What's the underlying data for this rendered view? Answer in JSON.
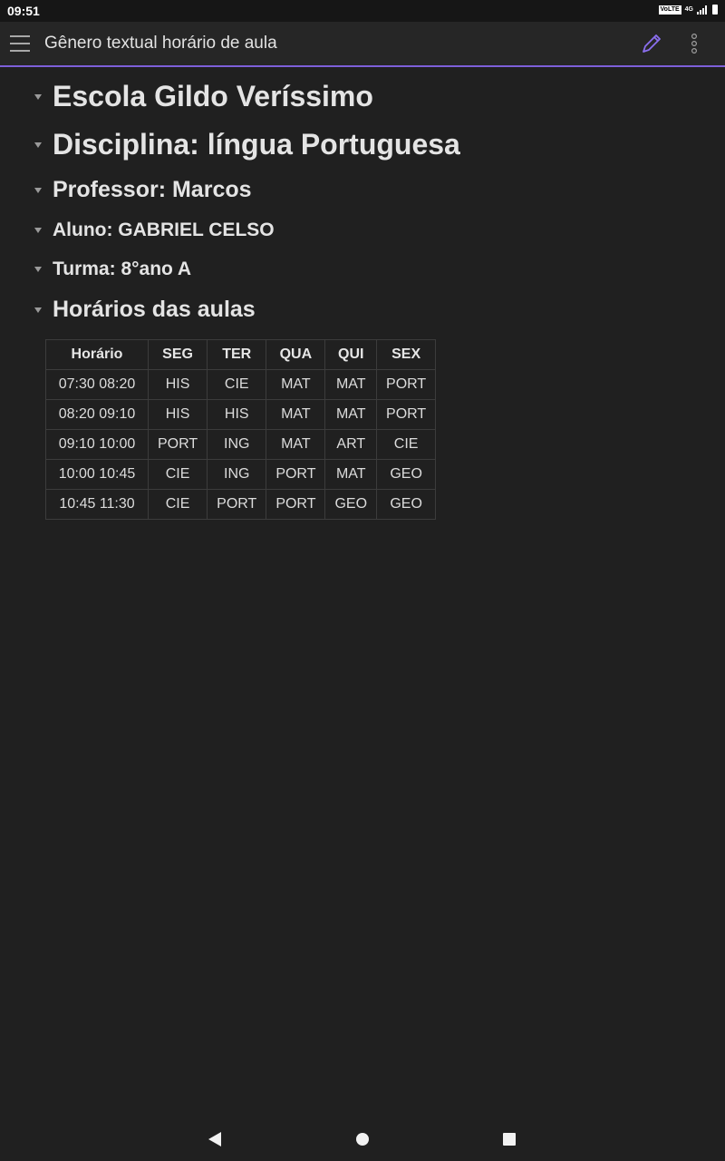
{
  "status_bar": {
    "time": "09:51",
    "volte": "VoLTE",
    "network": "4G"
  },
  "app_bar": {
    "title": "Gênero textual horário de aula",
    "menu_icon": "hamburger-menu-icon",
    "edit_icon": "pencil-icon",
    "more_icon": "vertical-dots-icon",
    "accent_color": "#7d5fd9"
  },
  "headings": [
    "Escola Gildo Veríssimo",
    "Disciplina: língua Portuguesa",
    "Professor: Marcos",
    "Aluno: GABRIEL CELSO",
    "Turma: 8°ano A",
    "Horários das aulas"
  ],
  "schedule": {
    "headers": [
      "Horário",
      "SEG",
      "TER",
      "QUA",
      "QUI",
      "SEX"
    ],
    "rows": [
      [
        "07:30 08:20",
        "HIS",
        "CIE",
        "MAT",
        "MAT",
        "PORT"
      ],
      [
        "08:20 09:10",
        "HIS",
        "HIS",
        "MAT",
        "MAT",
        "PORT"
      ],
      [
        "09:10 10:00",
        "PORT",
        "ING",
        "MAT",
        "ART",
        "CIE"
      ],
      [
        "10:00 10:45",
        "CIE",
        "ING",
        "PORT",
        "MAT",
        "GEO"
      ],
      [
        "10:45 11:30",
        "CIE",
        "PORT",
        "PORT",
        "GEO",
        "GEO"
      ]
    ]
  },
  "nav_bar": {
    "back_icon": "back-triangle-icon",
    "home_icon": "home-circle-icon",
    "recents_icon": "recents-square-icon"
  }
}
